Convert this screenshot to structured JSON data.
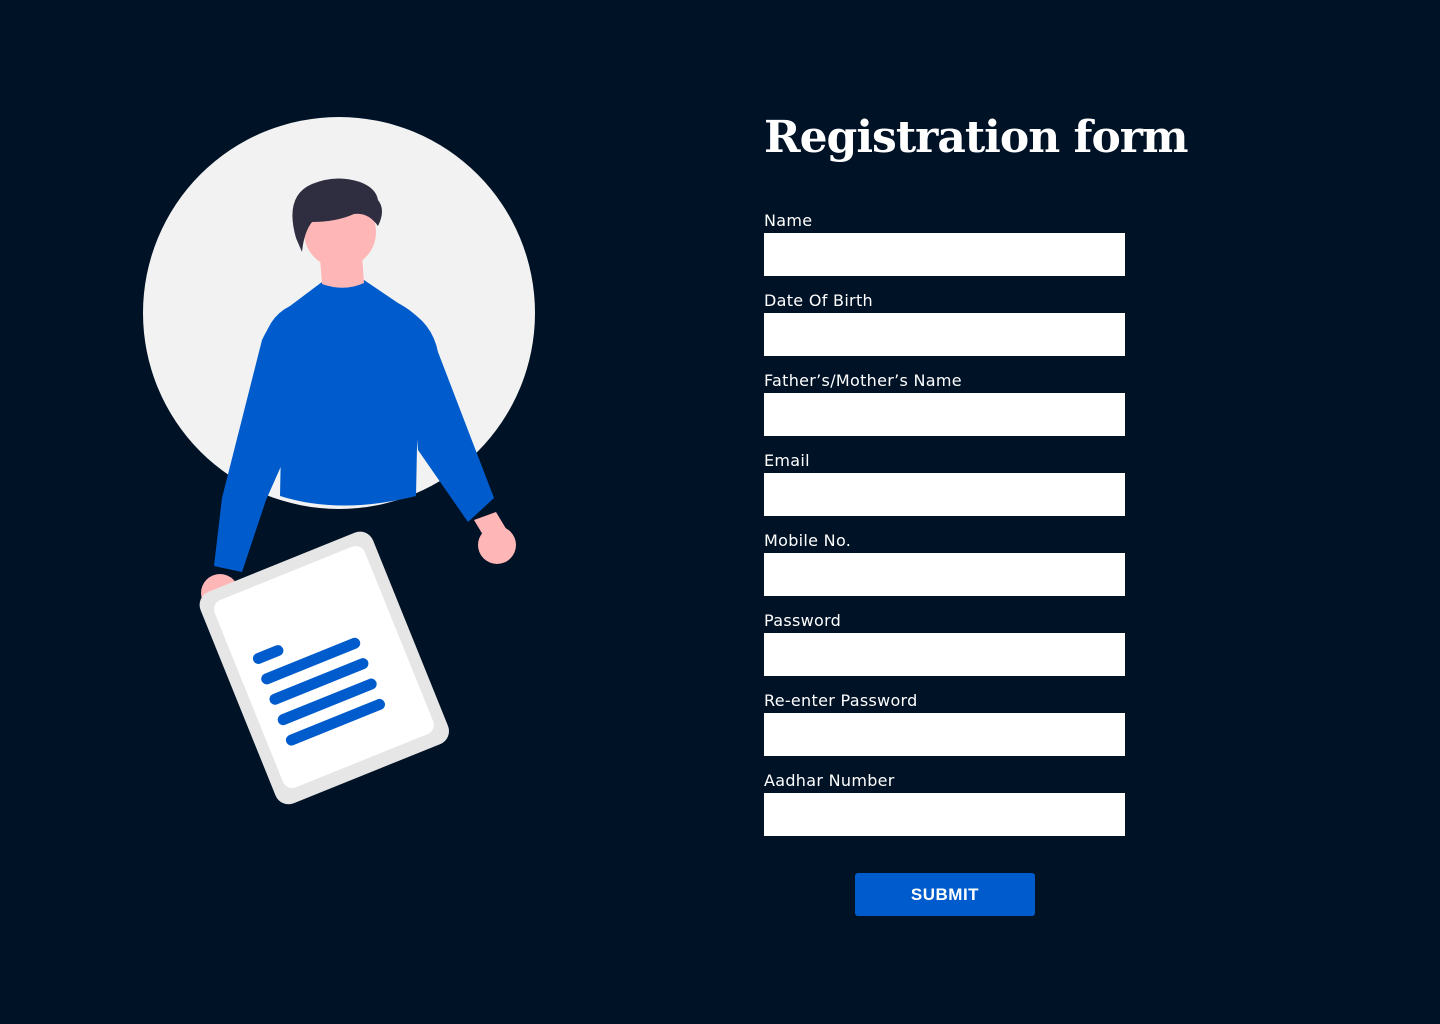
{
  "form": {
    "title": "Registration form",
    "fields": [
      {
        "label": "Name",
        "value": ""
      },
      {
        "label": "Date Of Birth",
        "value": ""
      },
      {
        "label": "Father’s/Mother’s Name",
        "value": ""
      },
      {
        "label": "Email",
        "value": ""
      },
      {
        "label": "Mobile No.",
        "value": ""
      },
      {
        "label": "Password",
        "value": ""
      },
      {
        "label": "Re-enter Password",
        "value": ""
      },
      {
        "label": "Aadhar Number",
        "value": ""
      }
    ],
    "submit_label": "SUBMIT"
  },
  "illustration": {
    "name": "person-holding-document-illustration"
  },
  "colors": {
    "background": "#001226",
    "accent": "#005ccc",
    "input_background": "#ffffff",
    "circle": "#f2f2f2",
    "skin": "#ffb6b6",
    "hair": "#2f2e41"
  }
}
